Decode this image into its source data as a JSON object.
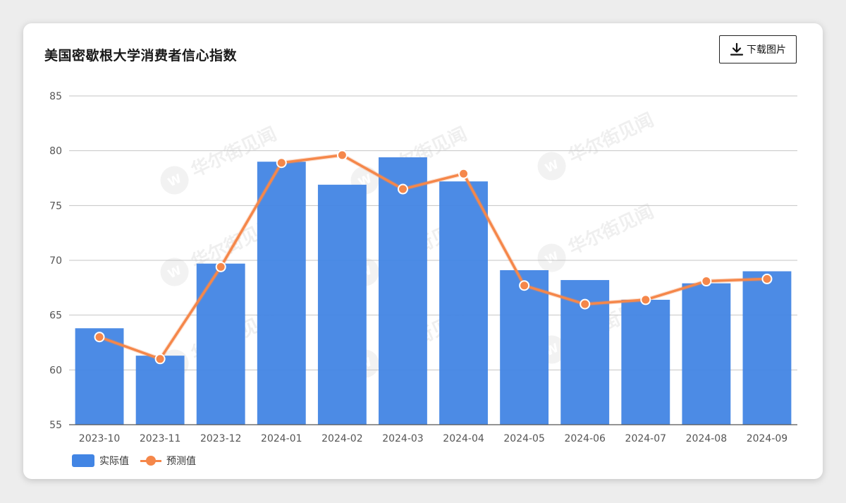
{
  "header": {
    "title": "美国密歇根大学消费者信心指数",
    "download_label": "下载图片"
  },
  "watermark": {
    "text": "华尔街见闻"
  },
  "colors": {
    "bar": "#4285e4",
    "line": "#f5874a",
    "grid": "#c4c4c4",
    "axis": "#555555",
    "tick_text": "#555555"
  },
  "chart_data": {
    "type": "bar",
    "title": "美国密歇根大学消费者信心指数",
    "xlabel": "",
    "ylabel": "",
    "categories": [
      "2023-10",
      "2023-11",
      "2023-12",
      "2024-01",
      "2024-02",
      "2024-03",
      "2024-04",
      "2024-05",
      "2024-06",
      "2024-07",
      "2024-08",
      "2024-09"
    ],
    "series": [
      {
        "name": "实际值",
        "type": "bar",
        "values": [
          63.8,
          61.3,
          69.7,
          79.0,
          76.9,
          79.4,
          77.2,
          69.1,
          68.2,
          66.4,
          67.9,
          69.0
        ]
      },
      {
        "name": "预测值",
        "type": "line",
        "values": [
          63.0,
          61.0,
          69.4,
          78.9,
          79.6,
          76.5,
          77.9,
          67.7,
          66.0,
          66.4,
          68.1,
          68.3
        ]
      }
    ],
    "ylim": [
      55,
      85
    ],
    "yticks": [
      55,
      60,
      65,
      70,
      75,
      80,
      85
    ],
    "grid": true,
    "legend": "bottom-left"
  }
}
